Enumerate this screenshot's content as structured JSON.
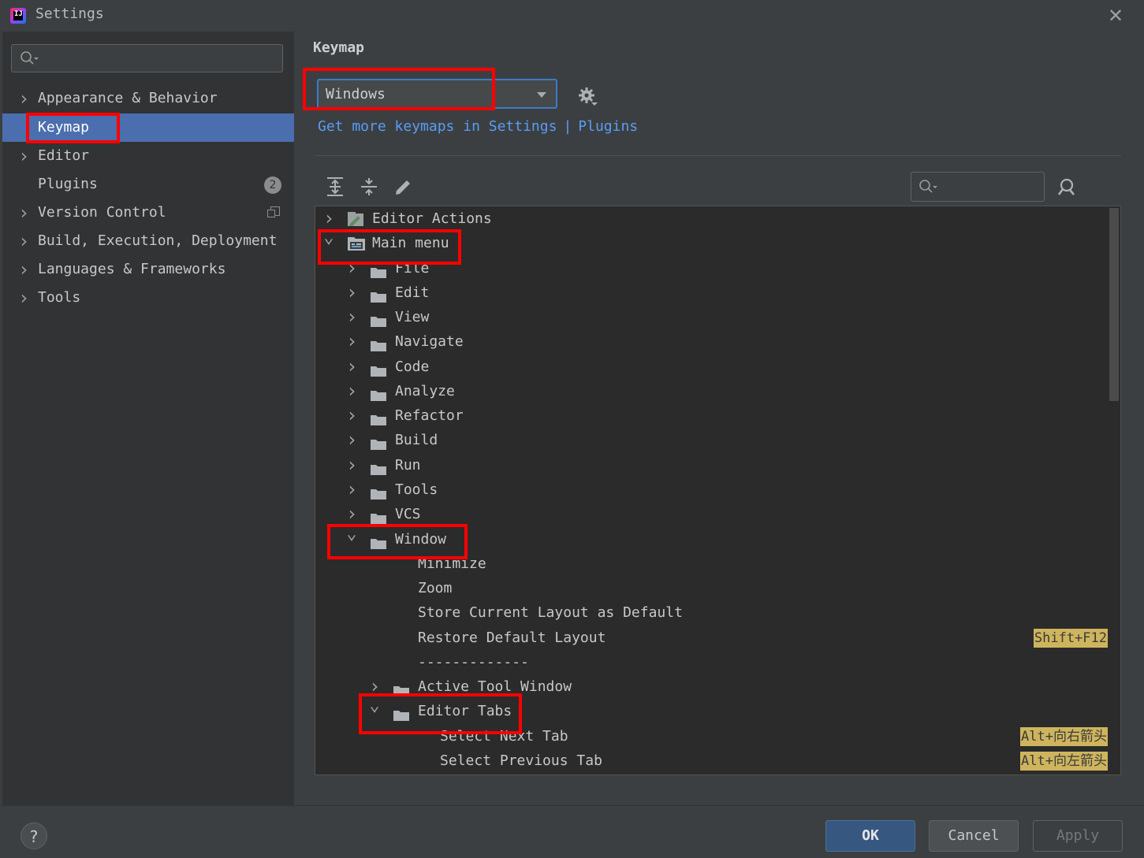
{
  "window": {
    "title": "Settings",
    "app_icon_text": "IJ"
  },
  "sidebar": {
    "search_placeholder": "",
    "items": [
      {
        "label": "Appearance & Behavior",
        "expandable": true
      },
      {
        "label": "Keymap",
        "selected": true
      },
      {
        "label": "Editor",
        "expandable": true
      },
      {
        "label": "Plugins",
        "badge": "2"
      },
      {
        "label": "Version Control",
        "expandable": true
      },
      {
        "label": "Build, Execution, Deployment",
        "expandable": true
      },
      {
        "label": "Languages & Frameworks",
        "expandable": true
      },
      {
        "label": "Tools",
        "expandable": true
      }
    ]
  },
  "content": {
    "title": "Keymap",
    "keymap_value": "Windows",
    "link_text": "Get more keymaps in Settings",
    "link_sep": "|",
    "link_plugins": "Plugins",
    "tree_search_placeholder": ""
  },
  "tree": [
    {
      "label": "Editor Actions",
      "state": "collapsed",
      "icon": "editor-actions-icon"
    },
    {
      "label": "Main menu",
      "state": "expanded",
      "icon": "main-menu-icon"
    },
    {
      "label": "File",
      "state": "collapsed",
      "icon": "folder-icon"
    },
    {
      "label": "Edit",
      "state": "collapsed",
      "icon": "folder-icon"
    },
    {
      "label": "View",
      "state": "collapsed",
      "icon": "folder-icon"
    },
    {
      "label": "Navigate",
      "state": "collapsed",
      "icon": "folder-icon"
    },
    {
      "label": "Code",
      "state": "collapsed",
      "icon": "folder-icon"
    },
    {
      "label": "Analyze",
      "state": "collapsed",
      "icon": "folder-icon"
    },
    {
      "label": "Refactor",
      "state": "collapsed",
      "icon": "folder-icon"
    },
    {
      "label": "Build",
      "state": "collapsed",
      "icon": "folder-icon"
    },
    {
      "label": "Run",
      "state": "collapsed",
      "icon": "folder-icon"
    },
    {
      "label": "Tools",
      "state": "collapsed",
      "icon": "folder-icon"
    },
    {
      "label": "VCS",
      "state": "collapsed",
      "icon": "folder-icon"
    },
    {
      "label": "Window",
      "state": "expanded",
      "icon": "folder-icon"
    },
    {
      "label": "Minimize",
      "state": "leaf"
    },
    {
      "label": "Zoom",
      "state": "leaf"
    },
    {
      "label": "Store Current Layout as Default",
      "state": "leaf"
    },
    {
      "label": "Restore Default Layout",
      "state": "leaf",
      "shortcut": "Shift+F12"
    },
    {
      "label": "-------------",
      "state": "separator"
    },
    {
      "label": "Active Tool Window",
      "state": "collapsed",
      "icon": "folder-icon"
    },
    {
      "label": "Editor Tabs",
      "state": "expanded",
      "icon": "folder-icon"
    },
    {
      "label": "Select Next Tab",
      "state": "leaf",
      "shortcut": "Alt+向右箭头"
    },
    {
      "label": "Select Previous Tab",
      "state": "leaf",
      "shortcut": "Alt+向左箭头"
    }
  ],
  "buttons": {
    "ok": "OK",
    "cancel": "Cancel",
    "apply": "Apply",
    "help": "?"
  },
  "colors": {
    "accent_selected": "#4b6eaf",
    "link": "#589df6",
    "shortcut_bg": "#ceb55d",
    "highlight_box": "#ff0000"
  }
}
